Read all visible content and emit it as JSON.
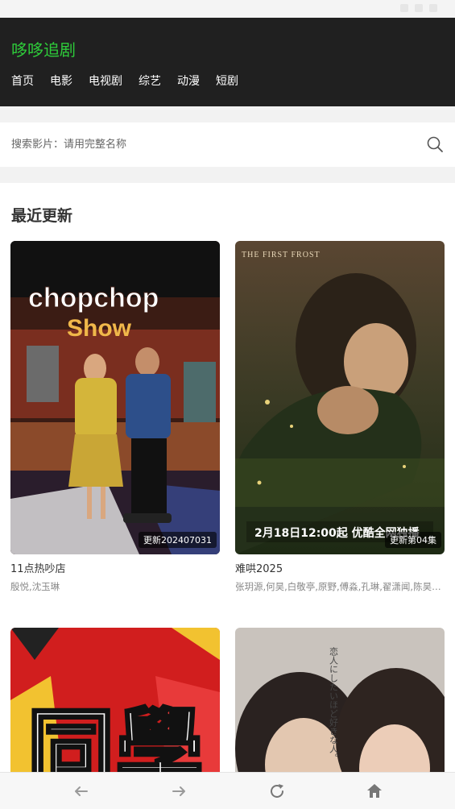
{
  "header": {
    "logo": "哆哆追剧",
    "nav": [
      "首页",
      "电影",
      "电视剧",
      "综艺",
      "动漫",
      "短剧"
    ]
  },
  "search": {
    "placeholder": "搜索影片：请用完整名称",
    "icon": "search-icon"
  },
  "section": {
    "title": "最近更新"
  },
  "cards": [
    {
      "title": "11点热吵店",
      "cast": "殷悦,沈玉琳",
      "badge": "更新202407031",
      "poster_text": "chopchop Show"
    },
    {
      "title": "难哄2025",
      "cast": "张玥源,何昊,白敬亭,原野,傅淼,孔琳,翟潇闻,陈昊…",
      "badge": "更新第04集",
      "poster_top": "THE    FIRST    FROST",
      "poster_bottom": "2月18日12:00起 优酷全网独播"
    },
    {
      "title": "",
      "cast": "",
      "badge": "",
      "poster_text": "同學"
    },
    {
      "title": "",
      "cast": "",
      "badge": "",
      "poster_text": "恋人にしたいほど好きな人。"
    }
  ],
  "bottom_nav": {
    "back": "arrow-left-icon",
    "forward": "arrow-right-icon",
    "reload": "reload-icon",
    "home": "home-icon"
  },
  "colors": {
    "brand": "#2ecc3a",
    "header_bg": "#202020"
  }
}
